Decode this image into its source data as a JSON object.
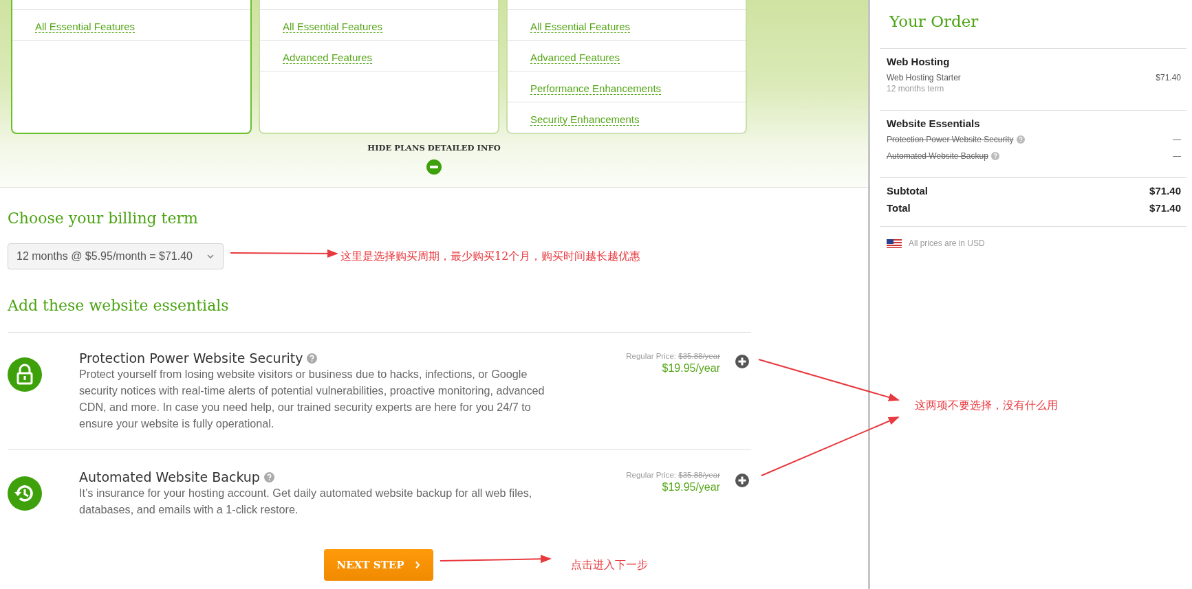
{
  "plans": [
    {
      "selected": true,
      "features": [
        "All Essential Features"
      ]
    },
    {
      "selected": false,
      "features": [
        "All Essential Features",
        "Advanced Features"
      ]
    },
    {
      "selected": false,
      "features": [
        "All Essential Features",
        "Advanced Features",
        "Performance Enhancements",
        "Security Enhancements"
      ]
    }
  ],
  "hide_details": {
    "label": "HIDE PLANS DETAILED INFO"
  },
  "billing": {
    "heading": "Choose your billing term",
    "value": "12 months @ $5.95/month = $71.40",
    "annotation": "这里是选择购买周期，最少购买12个月，购买时间越长越优惠"
  },
  "essentials": {
    "heading": "Add these website essentials",
    "annotation": "这两项不要选择，没有什么用",
    "items": [
      {
        "kind": "lock",
        "title": "Protection Power Website Security",
        "description": "Protect yourself from losing website visitors or business due to hacks, infections, or Google security notices with real-time alerts of potential vulnerabilities, proactive monitoring, advanced CDN, and more. In case you need help, our trained security experts are here for you 24/7 to ensure your website is fully operational.",
        "regular_label": "Regular Price:",
        "regular_price": "$35.88/year",
        "price": "$19.95/year"
      },
      {
        "kind": "backup",
        "title": "Automated Website Backup",
        "description": "It’s insurance for your hosting account. Get daily automated website backup for all web files, databases, and emails with a 1-click restore.",
        "regular_label": "Regular Price:",
        "regular_price": "$35.88/year",
        "price": "$19.95/year"
      }
    ]
  },
  "next_button": {
    "label": "NEXT STEP",
    "annotation": "点击进入下一步"
  },
  "order": {
    "title": "Your Order",
    "sections": [
      {
        "title": "Web Hosting",
        "lines": [
          {
            "name": "Web Hosting Starter",
            "detail": "12 months term",
            "amount": "$71.40",
            "removed": false,
            "help": false
          }
        ]
      },
      {
        "title": "Website Essentials",
        "lines": [
          {
            "name": "Protection Power Website Security",
            "amount": "—",
            "removed": true,
            "help": true
          },
          {
            "name": "Automated Website Backup",
            "amount": "—",
            "removed": true,
            "help": true
          }
        ]
      }
    ],
    "totals": [
      {
        "label": "Subtotal",
        "amount": "$71.40"
      },
      {
        "label": "Total",
        "amount": "$71.40"
      }
    ],
    "currency_note": "All prices are in USD"
  }
}
